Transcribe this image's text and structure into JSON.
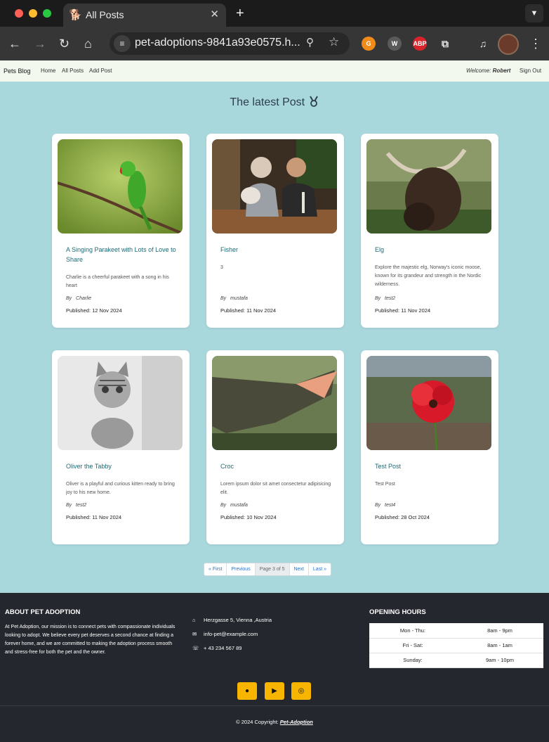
{
  "browser": {
    "tab_title": "All Posts",
    "tab_favicon": "🐕",
    "url": "pet-adoptions-9841a93e0575.h...",
    "new_tab": "+",
    "close": "✕",
    "ext_abp": "ABP"
  },
  "nav": {
    "brand": "Pets Blog",
    "links": [
      "Home",
      "All Posts",
      "Add Post"
    ],
    "welcome_label": "Welcome:",
    "welcome_user": "Robert",
    "sign_out": "Sign Out"
  },
  "page": {
    "heading": "The latest Post",
    "heading_icon": "medal-icon",
    "posts": [
      {
        "title": "A Singing Parakeet with Lots of Love to Share",
        "desc": "Charlie is a cheerful parakeet with a song in his heart",
        "by": "By",
        "author": "Charlie",
        "published": "Published: 12 Nov 2024",
        "image": "parakeet"
      },
      {
        "title": "Fisher",
        "desc": "3",
        "by": "By",
        "author": "mustafa",
        "published": "Published: 11 Nov 2024",
        "image": "people-with-dog"
      },
      {
        "title": "Elg",
        "desc": "Explore the majestic elg, Norway's iconic moose, known for its grandeur and strength in the Nordic wilderness.",
        "by": "By",
        "author": "test2",
        "published": "Published: 11 Nov 2024",
        "image": "moose"
      },
      {
        "title": "Oliver the Tabby",
        "desc": "Oliver is a playful and curious kitten ready to bring joy to his new home.",
        "by": "By",
        "author": "test2",
        "published": "Published: 11 Nov 2024",
        "image": "kitten"
      },
      {
        "title": "Croc",
        "desc": "Lorem ipsum dolor sit amet consectetur adipisicing elit.",
        "by": "By",
        "author": "mustafa",
        "published": "Published: 10 Nov 2024",
        "image": "crocodile"
      },
      {
        "title": "Test Post",
        "desc": "Test Post",
        "by": "By",
        "author": "test4",
        "published": "Published: 28 Oct 2024",
        "image": "red-flower"
      }
    ],
    "pagination": {
      "first": "« First",
      "previous": "Previous",
      "current": "Page 3 of 5",
      "next": "Next",
      "last": "Last »"
    }
  },
  "footer": {
    "about_heading": "ABOUT PET ADOPTION",
    "about_text": "At Pet Adoption, our mission is to connect pets with compassionate individuals looking to adopt. We believe every pet deserves a second chance at finding a forever home, and we are committed to making the adoption process smooth and stress-free for both the pet and the owner.",
    "address": "Herzgasse 5, Vienna ,Austria",
    "email": "info-pet@example.com",
    "phone": "+ 43 234 567 89",
    "hours_heading": "OPENING HOURS",
    "hours": [
      {
        "days": "Mon - Thu:",
        "time": "8am - 9pm"
      },
      {
        "days": "Fri - Sat:",
        "time": "8am - 1am"
      },
      {
        "days": "Sunday:",
        "time": "9am - 10pm"
      }
    ],
    "social_icons": [
      "facebook-icon",
      "youtube-icon",
      "instagram-icon"
    ],
    "copyright": "© 2024 Copyright:",
    "copyright_link": "Pet-Adoption"
  },
  "colors": {
    "main_bg": "#a8d7dc",
    "nav_bg": "#f2f8ee",
    "footer_bg": "#24272d",
    "accent": "#f7b500",
    "title": "#1c6b76"
  }
}
